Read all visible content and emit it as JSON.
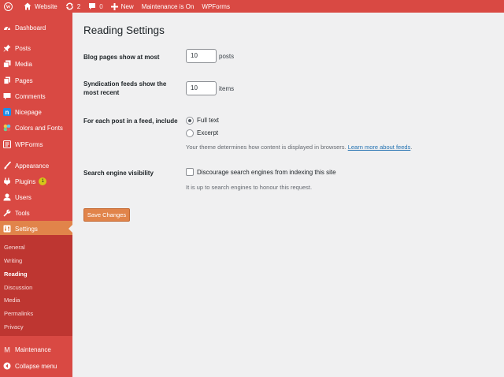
{
  "adminbar": {
    "site_name": "Website",
    "updates_count": "2",
    "comments_count": "0",
    "new_label": "New",
    "maintenance_label": "Maintenance is On",
    "wpforms_label": "WPForms"
  },
  "sidebar": {
    "items": [
      {
        "label": "Dashboard",
        "icon": "dashboard-icon"
      },
      {
        "label": "Posts",
        "icon": "pin-icon"
      },
      {
        "label": "Media",
        "icon": "media-icon"
      },
      {
        "label": "Pages",
        "icon": "pages-icon"
      },
      {
        "label": "Comments",
        "icon": "comment-icon"
      },
      {
        "label": "Nicepage",
        "icon": "nicepage-icon"
      },
      {
        "label": "Colors and Fonts",
        "icon": "palette-icon"
      },
      {
        "label": "WPForms",
        "icon": "form-icon"
      },
      {
        "label": "Appearance",
        "icon": "brush-icon"
      },
      {
        "label": "Plugins",
        "icon": "plugin-icon",
        "badge": "1"
      },
      {
        "label": "Users",
        "icon": "user-icon"
      },
      {
        "label": "Tools",
        "icon": "wrench-icon"
      },
      {
        "label": "Settings",
        "icon": "settings-icon"
      }
    ],
    "submenu": [
      "General",
      "Writing",
      "Reading",
      "Discussion",
      "Media",
      "Permalinks",
      "Privacy"
    ],
    "maintenance_label": "Maintenance",
    "collapse_label": "Collapse menu"
  },
  "main": {
    "title": "Reading Settings",
    "blog_pages_label": "Blog pages show at most",
    "blog_pages_value": "10",
    "blog_pages_suffix": "posts",
    "syndication_label": "Syndication feeds show the most recent",
    "syndication_value": "10",
    "syndication_suffix": "items",
    "feed_label": "For each post in a feed, include",
    "feed_options": [
      "Full text",
      "Excerpt"
    ],
    "feed_selected": "Full text",
    "feed_desc": "Your theme determines how content is displayed in browsers.",
    "feed_link": "Learn more about feeds",
    "feed_link_tail": ".",
    "search_label": "Search engine visibility",
    "search_checkbox_label": "Discourage search engines from indexing this site",
    "search_desc": "It is up to search engines to honour this request.",
    "save_label": "Save Changes"
  },
  "colors": {
    "admin_red": "#d94943",
    "submenu_red": "#be3631",
    "accent_orange": "#e1844a",
    "link_blue": "#2271b1"
  }
}
